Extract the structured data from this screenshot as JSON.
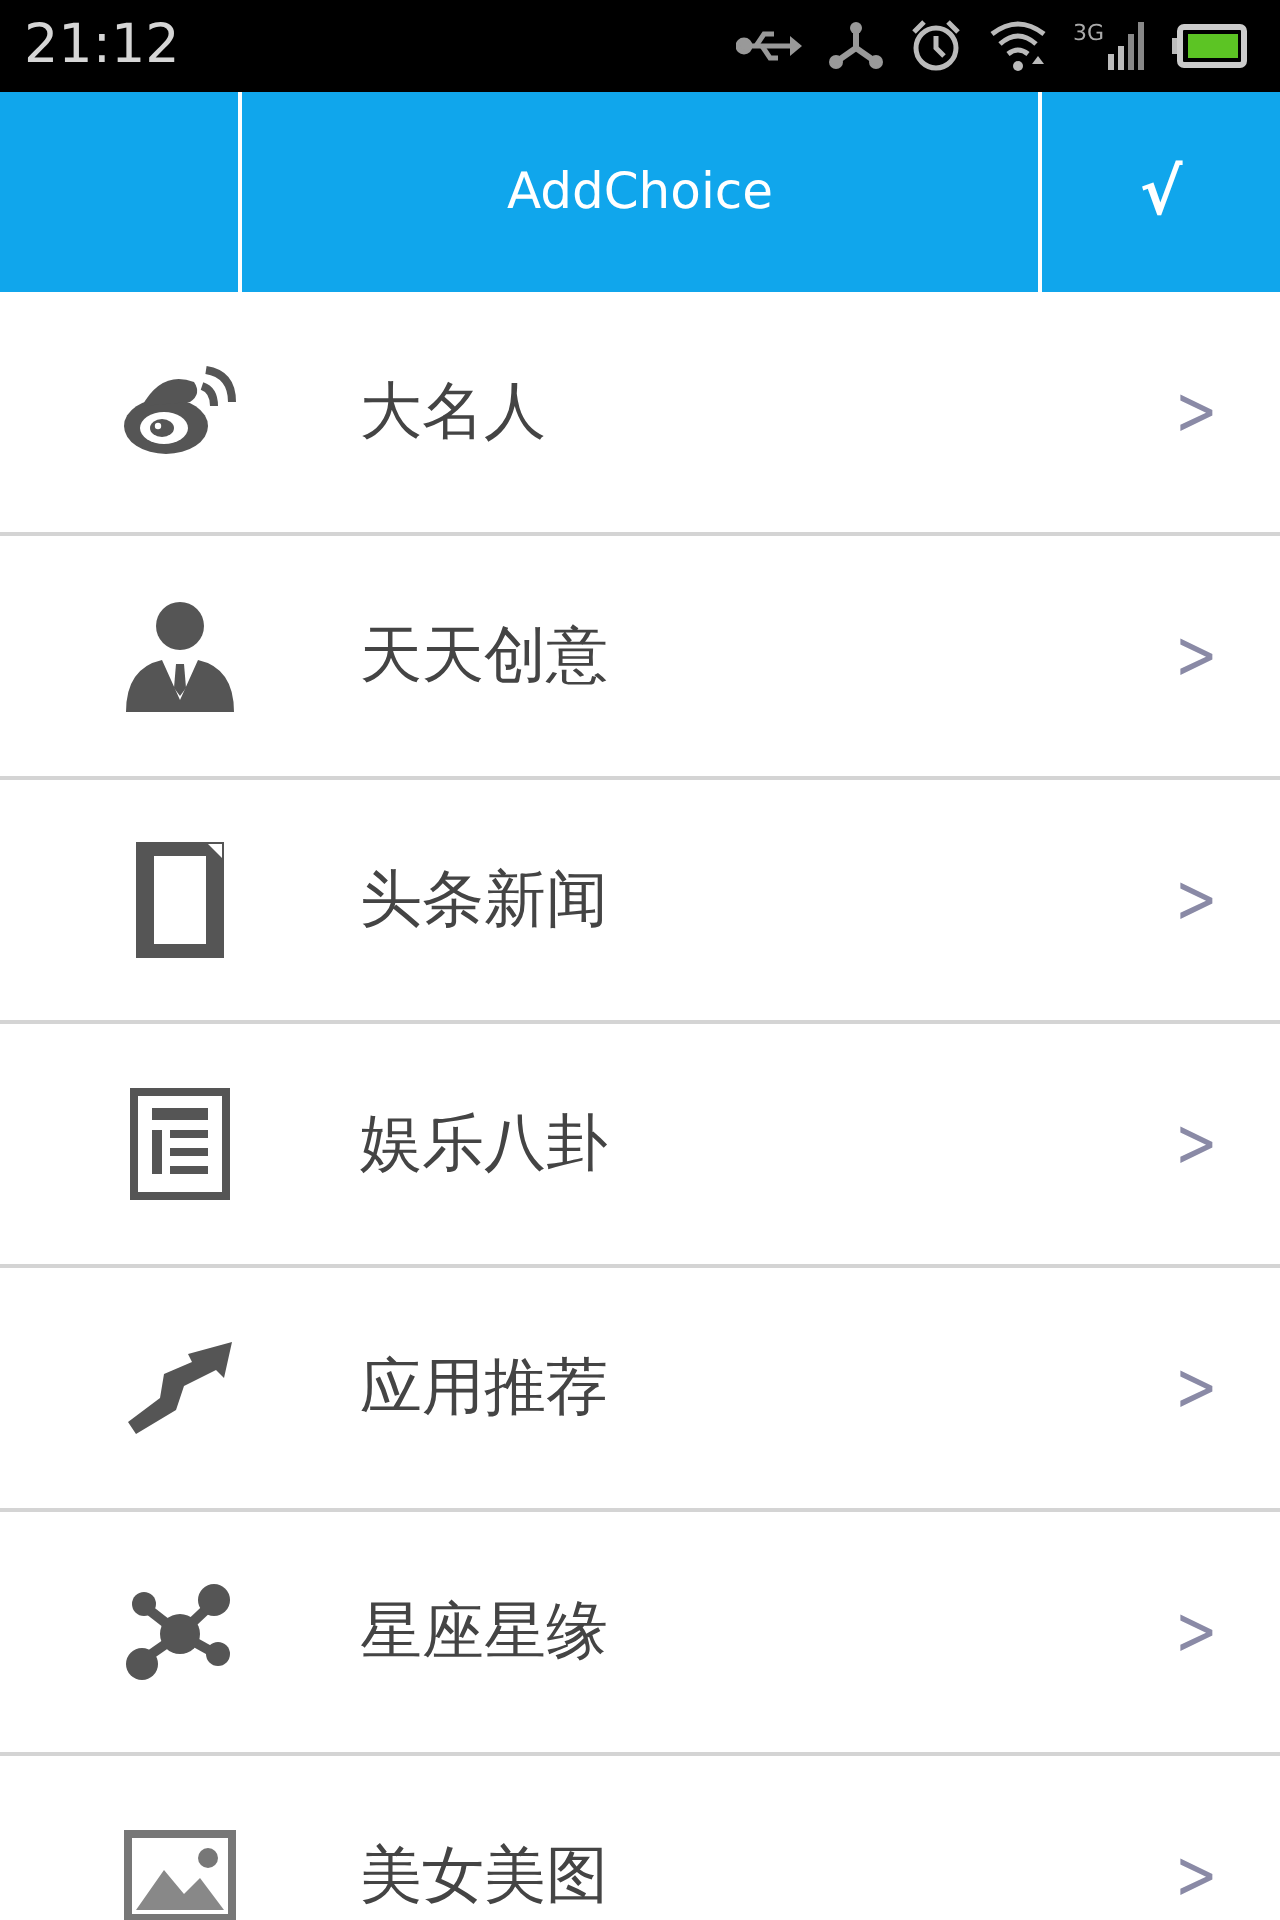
{
  "status_bar": {
    "time": "21:12",
    "network": "3G"
  },
  "header": {
    "title": "AddChoice",
    "confirm": "√"
  },
  "items": [
    {
      "kind": "weibo",
      "label": "大名人",
      "arrow": ">"
    },
    {
      "kind": "person",
      "label": "天天创意",
      "arrow": ">"
    },
    {
      "kind": "document",
      "label": "头条新闻",
      "arrow": ">"
    },
    {
      "kind": "article",
      "label": "娱乐八卦",
      "arrow": ">"
    },
    {
      "kind": "trend",
      "label": "应用推荐",
      "arrow": ">"
    },
    {
      "kind": "network",
      "label": "星座星缘",
      "arrow": ">"
    },
    {
      "kind": "image",
      "label": "美女美图",
      "arrow": ">"
    }
  ]
}
